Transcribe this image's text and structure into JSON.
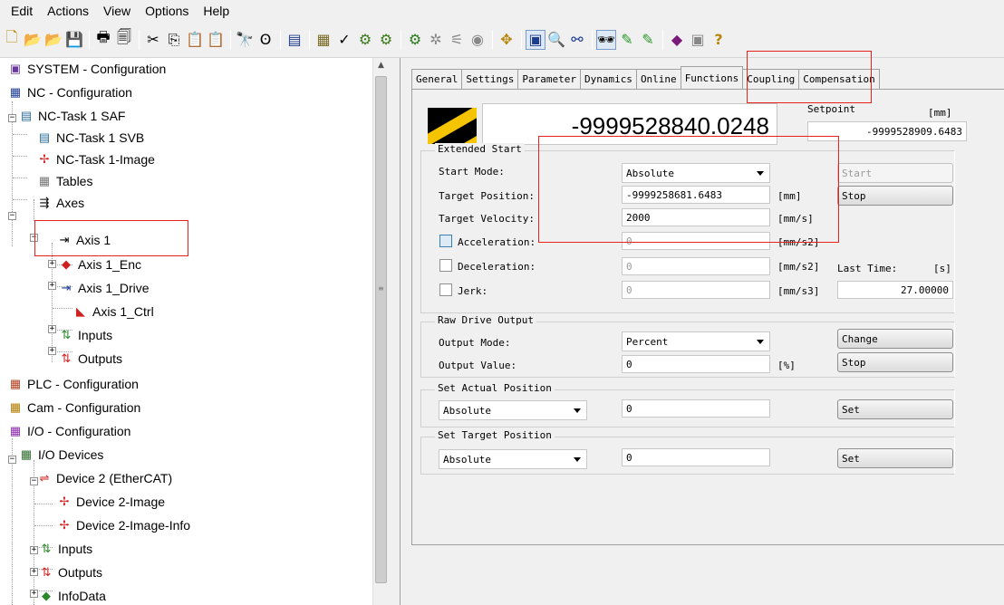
{
  "menu": [
    "Edit",
    "Actions",
    "View",
    "Options",
    "Help"
  ],
  "toolbar": {
    "icons": [
      "new-file-icon",
      "open-folder-icon",
      "open-remote-icon",
      "save-icon",
      "print-icon",
      "print-preview-icon",
      "cut-icon",
      "copy-icon",
      "paste-icon",
      "paste-special-icon",
      "find-icon",
      "find-next-icon",
      "generate-mappings-icon",
      "check-configuration-icon",
      "activate-configuration-icon",
      "set-run-mode-icon",
      "set-config-mode-icon",
      "reload-devices-icon",
      "scan-devices-icon",
      "toggle-free-run-icon",
      "config-target-icon",
      "show-online-data-icon",
      "zoom-icon",
      "network-icon",
      "watch-icon",
      "plc-online-icon",
      "plc-variables-icon",
      "book-icon",
      "settings-icon",
      "help-icon"
    ],
    "pressed": [
      "show-online-data-icon",
      "watch-icon"
    ]
  },
  "tree": {
    "nodes": [
      {
        "label": "SYSTEM - Configuration",
        "icon": "system-icon"
      },
      {
        "label": "NC - Configuration",
        "icon": "nc-icon"
      },
      {
        "label": "NC-Task 1 SAF",
        "icon": "task-icon"
      },
      {
        "label": "NC-Task 1 SVB",
        "icon": "task-icon"
      },
      {
        "label": "NC-Task 1-Image",
        "icon": "image-icon"
      },
      {
        "label": "Tables",
        "icon": "table-icon"
      },
      {
        "label": "Axes",
        "icon": "axes-icon"
      },
      {
        "label": "Axis 1",
        "icon": "axis-icon"
      },
      {
        "label": "Axis 1_Enc",
        "icon": "encoder-icon"
      },
      {
        "label": "Axis 1_Drive",
        "icon": "drive-icon"
      },
      {
        "label": "Axis 1_Ctrl",
        "icon": "controller-icon"
      },
      {
        "label": "Inputs",
        "icon": "inputs-icon"
      },
      {
        "label": "Outputs",
        "icon": "outputs-icon"
      },
      {
        "label": "PLC - Configuration",
        "icon": "plc-icon"
      },
      {
        "label": "Cam - Configuration",
        "icon": "cam-icon"
      },
      {
        "label": "I/O - Configuration",
        "icon": "io-icon"
      },
      {
        "label": "I/O Devices",
        "icon": "io-devices-icon"
      },
      {
        "label": "Device 2 (EtherCAT)",
        "icon": "ethercat-icon"
      },
      {
        "label": "Device 2-Image",
        "icon": "image-icon"
      },
      {
        "label": "Device 2-Image-Info",
        "icon": "image-icon"
      },
      {
        "label": "Inputs",
        "icon": "inputs-icon"
      },
      {
        "label": "Outputs",
        "icon": "outputs-icon"
      },
      {
        "label": "InfoData",
        "icon": "infodata-icon"
      }
    ]
  },
  "tabs": [
    "General",
    "Settings",
    "Parameter",
    "Dynamics",
    "Online",
    "Functions",
    "Coupling",
    "Compensation"
  ],
  "active_tab": "Functions",
  "actual_position": "-9999528840.0248",
  "setpoint": {
    "label": "Setpoint",
    "unit": "[mm]",
    "value": "-9999528909.6483"
  },
  "extended_start": {
    "title": "Extended Start",
    "start_mode_label": "Start Mode:",
    "start_mode_value": "Absolute",
    "target_position_label": "Target Position:",
    "target_position_value": "-9999258681.6483",
    "target_position_unit": "[mm]",
    "target_velocity_label": "Target Velocity:",
    "target_velocity_value": "2000",
    "target_velocity_unit": "[mm/s]",
    "acceleration_label": "Acceleration:",
    "acceleration_value": "0",
    "acceleration_unit": "[mm/s2]",
    "deceleration_label": "Deceleration:",
    "deceleration_value": "0",
    "deceleration_unit": "[mm/s2]",
    "jerk_label": "Jerk:",
    "jerk_value": "0",
    "jerk_unit": "[mm/s3]",
    "start_button": "Start",
    "stop_button": "Stop",
    "last_time_label": "Last Time:",
    "last_time_unit": "[s]",
    "last_time_value": "27.00000"
  },
  "raw_drive_output": {
    "title": "Raw Drive Output",
    "output_mode_label": "Output Mode:",
    "output_mode_value": "Percent",
    "output_value_label": "Output Value:",
    "output_value": "0",
    "output_value_unit": "[%]",
    "change_button": "Change",
    "stop_button": "Stop"
  },
  "set_actual_position": {
    "title": "Set Actual Position",
    "mode_value": "Absolute",
    "value": "0",
    "set_button": "Set"
  },
  "set_target_position": {
    "title": "Set Target Position",
    "mode_value": "Absolute",
    "value": "0",
    "set_button": "Set"
  },
  "colors": {
    "highlight_border": "#e8211b",
    "window_bg": "#f0f0f0"
  }
}
